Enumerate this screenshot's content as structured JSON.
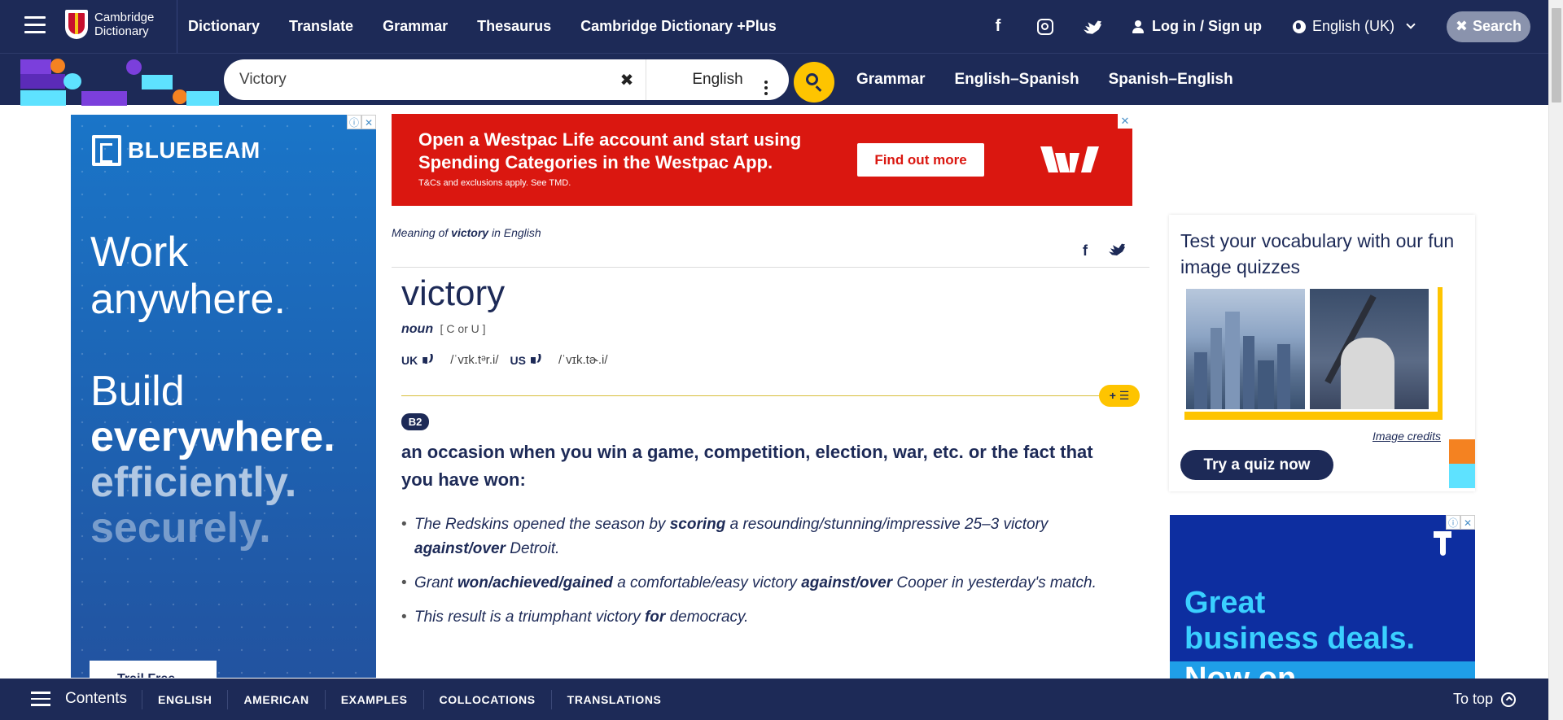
{
  "header": {
    "logo_line1": "Cambridge",
    "logo_line2": "Dictionary",
    "nav": [
      "Dictionary",
      "Translate",
      "Grammar",
      "Thesaurus",
      "Cambridge Dictionary +Plus"
    ],
    "login_label": "Log in / Sign up",
    "language_label": "English (UK)",
    "search_label": "Search",
    "social_icons": [
      "facebook-icon",
      "instagram-icon",
      "twitter-icon"
    ]
  },
  "search": {
    "value": "Victory",
    "dictionary": "English",
    "links": [
      "Grammar",
      "English–Spanish",
      "Spanish–English"
    ]
  },
  "ads": {
    "left": {
      "brand": "BLUEBEAM",
      "headline_1a": "Work",
      "headline_1b": "anywhere.",
      "headline_2a": "Build",
      "headline_2b": "everywhere.",
      "headline_2c": "efficiently.",
      "headline_2d": "securely.",
      "cta": "Trail Free"
    },
    "top": {
      "line1": "Open a Westpac Life account and start using",
      "line2": "Spending Categories in the Westpac App.",
      "small": "T&Cs and exclusions apply. See TMD.",
      "cta": "Find out more"
    },
    "right": {
      "line1": "Great",
      "line2": "business deals.",
      "line3": "Now on"
    }
  },
  "entry": {
    "meaning_prefix": "Meaning of",
    "meaning_word": "victory",
    "meaning_suffix": "in English",
    "headword": "victory",
    "pos": "noun",
    "grammar": "[ C or U ]",
    "uk_label": "UK",
    "uk_ipa": "/ˈvɪk.tᵊr.i/",
    "us_label": "US",
    "us_ipa": "/ˈvɪk.tɚ.i/",
    "level": "B2",
    "definition": "an occasion when you win a game, competition, election, war, etc. or the fact that you have won:",
    "examples": [
      [
        "The Redskins opened the season by ",
        "scoring",
        " a resounding/stunning/impressive 25–3 victory ",
        "against/over",
        " Detroit."
      ],
      [
        "Grant ",
        "won/achieved/gained",
        " a comfortable/easy victory ",
        "against/over",
        " Cooper in yesterday's match."
      ],
      [
        "This result is a triumphant victory ",
        "for",
        " democracy.",
        "",
        ""
      ]
    ],
    "wordlist_button": "+ ☰"
  },
  "quiz": {
    "title": "Test your vocabulary with our fun image quizzes",
    "credits": "Image credits",
    "button": "Try a quiz now"
  },
  "bottom": {
    "contents": "Contents",
    "tabs": [
      "ENGLISH",
      "AMERICAN",
      "EXAMPLES",
      "COLLOCATIONS",
      "TRANSLATIONS"
    ],
    "to_top": "To top"
  },
  "colors": {
    "navy": "#1d2a57",
    "yellow": "#fec400",
    "westpac_red": "#da1710",
    "bluebeam_blue": "#1a75c8"
  }
}
